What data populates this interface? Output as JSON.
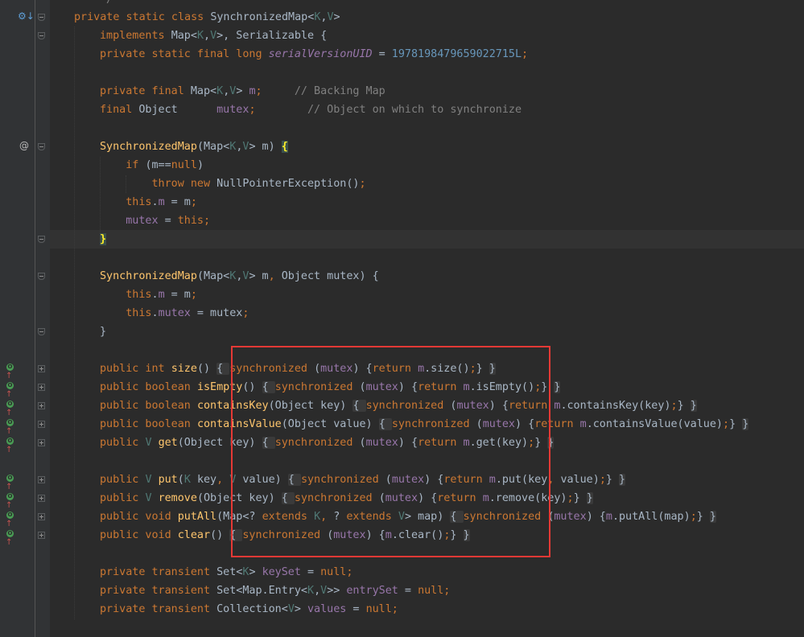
{
  "top_fragment": "*/",
  "lines": [
    {
      "id": "class-decl",
      "tokens": [
        [
          "kw",
          "private static class "
        ],
        [
          "sy",
          "SynchronizedMap<"
        ],
        [
          "tp",
          "K"
        ],
        [
          "sy",
          ","
        ],
        [
          "tp",
          "V"
        ],
        [
          "sy",
          ">"
        ]
      ]
    },
    {
      "id": "implements",
      "tokens": [
        [
          "kw",
          "implements "
        ],
        [
          "sy",
          "Map<"
        ],
        [
          "tp",
          "K"
        ],
        [
          "sy",
          ","
        ],
        [
          "tp",
          "V"
        ],
        [
          "sy",
          ">, Serializable {"
        ]
      ]
    },
    {
      "id": "serial",
      "tokens": [
        [
          "kw",
          "private static final long "
        ],
        [
          "ifld",
          "serialVersionUID"
        ],
        [
          "sy",
          " = "
        ],
        [
          "num",
          "1978198479659022715L"
        ],
        [
          "kw",
          ";"
        ]
      ]
    },
    {
      "id": "blank1",
      "tokens": []
    },
    {
      "id": "field-m",
      "tokens": [
        [
          "kw",
          "private final "
        ],
        [
          "sy",
          "Map<"
        ],
        [
          "tp",
          "K"
        ],
        [
          "sy",
          ","
        ],
        [
          "tp",
          "V"
        ],
        [
          "sy",
          "> "
        ],
        [
          "fld",
          "m"
        ],
        [
          "kw",
          ";"
        ],
        [
          "cm",
          "     // Backing Map"
        ]
      ]
    },
    {
      "id": "field-mutex",
      "tokens": [
        [
          "kw",
          "final "
        ],
        [
          "sy",
          "Object      "
        ],
        [
          "fld",
          "mutex"
        ],
        [
          "kw",
          ";"
        ],
        [
          "cm",
          "        // Object on which to synchronize"
        ]
      ]
    },
    {
      "id": "blank2",
      "tokens": []
    },
    {
      "id": "ctor1",
      "tokens": [
        [
          "fn",
          "SynchronizedMap"
        ],
        [
          "sy",
          "(Map<"
        ],
        [
          "tp",
          "K"
        ],
        [
          "sy",
          ","
        ],
        [
          "tp",
          "V"
        ],
        [
          "sy",
          "> m) "
        ],
        [
          "brhl",
          "{"
        ]
      ]
    },
    {
      "id": "if-null",
      "tokens": [
        [
          "kw",
          "    if "
        ],
        [
          "sy",
          "(m=="
        ],
        [
          "kw",
          "null"
        ],
        [
          "sy",
          ")"
        ]
      ]
    },
    {
      "id": "throw",
      "tokens": [
        [
          "kw",
          "        throw new "
        ],
        [
          "sy",
          "NullPointerException()"
        ],
        [
          "kw",
          ";"
        ]
      ]
    },
    {
      "id": "this-m",
      "tokens": [
        [
          "kw",
          "    this"
        ],
        [
          "sy",
          "."
        ],
        [
          "fld",
          "m"
        ],
        [
          "sy",
          " = m"
        ],
        [
          "kw",
          ";"
        ]
      ]
    },
    {
      "id": "mutex-this",
      "tokens": [
        [
          "fld",
          "    mutex"
        ],
        [
          "sy",
          " = "
        ],
        [
          "kw",
          "this;"
        ]
      ]
    },
    {
      "id": "ctor1-close",
      "tokens": [
        [
          "brhl",
          "}"
        ]
      ]
    },
    {
      "id": "blank3",
      "tokens": []
    },
    {
      "id": "ctor2",
      "tokens": [
        [
          "fn",
          "SynchronizedMap"
        ],
        [
          "sy",
          "(Map<"
        ],
        [
          "tp",
          "K"
        ],
        [
          "sy",
          ","
        ],
        [
          "tp",
          "V"
        ],
        [
          "sy",
          "> m"
        ],
        [
          "kw",
          ", "
        ],
        [
          "sy",
          "Object mutex) {"
        ]
      ]
    },
    {
      "id": "this-m2",
      "tokens": [
        [
          "kw",
          "    this"
        ],
        [
          "sy",
          "."
        ],
        [
          "fld",
          "m"
        ],
        [
          "sy",
          " = m"
        ],
        [
          "kw",
          ";"
        ]
      ]
    },
    {
      "id": "this-mutex",
      "tokens": [
        [
          "kw",
          "    this"
        ],
        [
          "sy",
          "."
        ],
        [
          "fld",
          "mutex"
        ],
        [
          "sy",
          " = mutex"
        ],
        [
          "kw",
          ";"
        ]
      ]
    },
    {
      "id": "ctor2-close",
      "tokens": [
        [
          "sy",
          "}"
        ]
      ]
    },
    {
      "id": "blank4",
      "tokens": []
    },
    {
      "id": "size",
      "tokens": [
        [
          "kw",
          "public int "
        ],
        [
          "fn",
          "size"
        ],
        [
          "sy",
          "() "
        ],
        [
          "folded",
          "{ "
        ],
        [
          "kw",
          "synchronized "
        ],
        [
          "sy",
          "("
        ],
        [
          "fld",
          "mutex"
        ],
        [
          "sy",
          ") {"
        ],
        [
          "kw",
          "return "
        ],
        [
          "fld",
          "m"
        ],
        [
          "sy",
          ".size()"
        ],
        [
          "kw",
          ";"
        ],
        [
          "sy",
          "} "
        ],
        [
          "folded",
          "}"
        ]
      ]
    },
    {
      "id": "isEmpty",
      "tokens": [
        [
          "kw",
          "public boolean "
        ],
        [
          "fn",
          "isEmpty"
        ],
        [
          "sy",
          "() "
        ],
        [
          "folded",
          "{ "
        ],
        [
          "kw",
          "synchronized "
        ],
        [
          "sy",
          "("
        ],
        [
          "fld",
          "mutex"
        ],
        [
          "sy",
          ") {"
        ],
        [
          "kw",
          "return "
        ],
        [
          "fld",
          "m"
        ],
        [
          "sy",
          ".isEmpty()"
        ],
        [
          "kw",
          ";"
        ],
        [
          "sy",
          "} "
        ],
        [
          "folded",
          "}"
        ]
      ]
    },
    {
      "id": "containsKey",
      "tokens": [
        [
          "kw",
          "public boolean "
        ],
        [
          "fn",
          "containsKey"
        ],
        [
          "sy",
          "(Object key) "
        ],
        [
          "folded",
          "{ "
        ],
        [
          "kw",
          "synchronized "
        ],
        [
          "sy",
          "("
        ],
        [
          "fld",
          "mutex"
        ],
        [
          "sy",
          ") {"
        ],
        [
          "kw",
          "return "
        ],
        [
          "fld",
          "m"
        ],
        [
          "sy",
          ".containsKey(key)"
        ],
        [
          "kw",
          ";"
        ],
        [
          "sy",
          "} "
        ],
        [
          "folded",
          "}"
        ]
      ]
    },
    {
      "id": "containsValue",
      "tokens": [
        [
          "kw",
          "public boolean "
        ],
        [
          "fn",
          "containsValue"
        ],
        [
          "sy",
          "(Object value) "
        ],
        [
          "folded",
          "{ "
        ],
        [
          "kw",
          "synchronized "
        ],
        [
          "sy",
          "("
        ],
        [
          "fld",
          "mutex"
        ],
        [
          "sy",
          ") {"
        ],
        [
          "kw",
          "return "
        ],
        [
          "fld",
          "m"
        ],
        [
          "sy",
          ".containsValue(value)"
        ],
        [
          "kw",
          ";"
        ],
        [
          "sy",
          "} "
        ],
        [
          "folded",
          "}"
        ]
      ]
    },
    {
      "id": "get",
      "tokens": [
        [
          "kw",
          "public "
        ],
        [
          "tp",
          "V "
        ],
        [
          "fn",
          "get"
        ],
        [
          "sy",
          "(Object key) "
        ],
        [
          "folded",
          "{ "
        ],
        [
          "kw",
          "synchronized "
        ],
        [
          "sy",
          "("
        ],
        [
          "fld",
          "mutex"
        ],
        [
          "sy",
          ") {"
        ],
        [
          "kw",
          "return "
        ],
        [
          "fld",
          "m"
        ],
        [
          "sy",
          ".get(key)"
        ],
        [
          "kw",
          ";"
        ],
        [
          "sy",
          "} "
        ],
        [
          "folded",
          "}"
        ]
      ]
    },
    {
      "id": "blank5",
      "tokens": []
    },
    {
      "id": "put",
      "tokens": [
        [
          "kw",
          "public "
        ],
        [
          "tp",
          "V "
        ],
        [
          "fn",
          "put"
        ],
        [
          "sy",
          "("
        ],
        [
          "tp",
          "K "
        ],
        [
          "sy",
          "key"
        ],
        [
          "kw",
          ", "
        ],
        [
          "tp",
          "V "
        ],
        [
          "sy",
          "value) "
        ],
        [
          "folded",
          "{ "
        ],
        [
          "kw",
          "synchronized "
        ],
        [
          "sy",
          "("
        ],
        [
          "fld",
          "mutex"
        ],
        [
          "sy",
          ") {"
        ],
        [
          "kw",
          "return "
        ],
        [
          "fld",
          "m"
        ],
        [
          "sy",
          ".put(key"
        ],
        [
          "kw",
          ", "
        ],
        [
          "sy",
          "value)"
        ],
        [
          "kw",
          ";"
        ],
        [
          "sy",
          "} "
        ],
        [
          "folded",
          "}"
        ]
      ]
    },
    {
      "id": "remove",
      "tokens": [
        [
          "kw",
          "public "
        ],
        [
          "tp",
          "V "
        ],
        [
          "fn",
          "remove"
        ],
        [
          "sy",
          "(Object key) "
        ],
        [
          "folded",
          "{ "
        ],
        [
          "kw",
          "synchronized "
        ],
        [
          "sy",
          "("
        ],
        [
          "fld",
          "mutex"
        ],
        [
          "sy",
          ") {"
        ],
        [
          "kw",
          "return "
        ],
        [
          "fld",
          "m"
        ],
        [
          "sy",
          ".remove(key)"
        ],
        [
          "kw",
          ";"
        ],
        [
          "sy",
          "} "
        ],
        [
          "folded",
          "}"
        ]
      ]
    },
    {
      "id": "putAll",
      "tokens": [
        [
          "kw",
          "public void "
        ],
        [
          "fn",
          "putAll"
        ],
        [
          "sy",
          "(Map<? "
        ],
        [
          "kw",
          "extends "
        ],
        [
          "tp",
          "K"
        ],
        [
          "kw",
          ", "
        ],
        [
          "sy",
          "? "
        ],
        [
          "kw",
          "extends "
        ],
        [
          "tp",
          "V"
        ],
        [
          "sy",
          "> map) "
        ],
        [
          "folded",
          "{ "
        ],
        [
          "kw",
          "synchronized "
        ],
        [
          "sy",
          "("
        ],
        [
          "fld",
          "mutex"
        ],
        [
          "sy",
          ") {"
        ],
        [
          "fld",
          "m"
        ],
        [
          "sy",
          ".putAll(map)"
        ],
        [
          "kw",
          ";"
        ],
        [
          "sy",
          "} "
        ],
        [
          "folded",
          "}"
        ]
      ]
    },
    {
      "id": "clear",
      "tokens": [
        [
          "kw",
          "public void "
        ],
        [
          "fn",
          "clear"
        ],
        [
          "sy",
          "() "
        ],
        [
          "folded",
          "{ "
        ],
        [
          "kw",
          "synchronized "
        ],
        [
          "sy",
          "("
        ],
        [
          "fld",
          "mutex"
        ],
        [
          "sy",
          ") {"
        ],
        [
          "fld",
          "m"
        ],
        [
          "sy",
          ".clear()"
        ],
        [
          "kw",
          ";"
        ],
        [
          "sy",
          "} "
        ],
        [
          "folded",
          "}"
        ]
      ]
    },
    {
      "id": "blank6",
      "tokens": []
    },
    {
      "id": "keySet",
      "tokens": [
        [
          "kw",
          "private transient "
        ],
        [
          "sy",
          "Set<"
        ],
        [
          "tp",
          "K"
        ],
        [
          "sy",
          "> "
        ],
        [
          "fld",
          "keySet"
        ],
        [
          "sy",
          " = "
        ],
        [
          "kw",
          "null;"
        ]
      ]
    },
    {
      "id": "entrySet",
      "tokens": [
        [
          "kw",
          "private transient "
        ],
        [
          "sy",
          "Set<Map.Entry<"
        ],
        [
          "tp",
          "K"
        ],
        [
          "sy",
          ","
        ],
        [
          "tp",
          "V"
        ],
        [
          "sy",
          ">> "
        ],
        [
          "fld",
          "entrySet"
        ],
        [
          "sy",
          " = "
        ],
        [
          "kw",
          "null;"
        ]
      ]
    },
    {
      "id": "values",
      "tokens": [
        [
          "kw",
          "private transient "
        ],
        [
          "sy",
          "Collection<"
        ],
        [
          "tp",
          "V"
        ],
        [
          "sy",
          "> "
        ],
        [
          "fld",
          "values"
        ],
        [
          "sy",
          " = "
        ],
        [
          "kw",
          "null;"
        ]
      ]
    }
  ],
  "gutter_marks": {
    "override_icon_letter": "O",
    "override_arrow": "↑",
    "implemented_glyph": "⚙↓",
    "annotation_glyph": "@"
  }
}
